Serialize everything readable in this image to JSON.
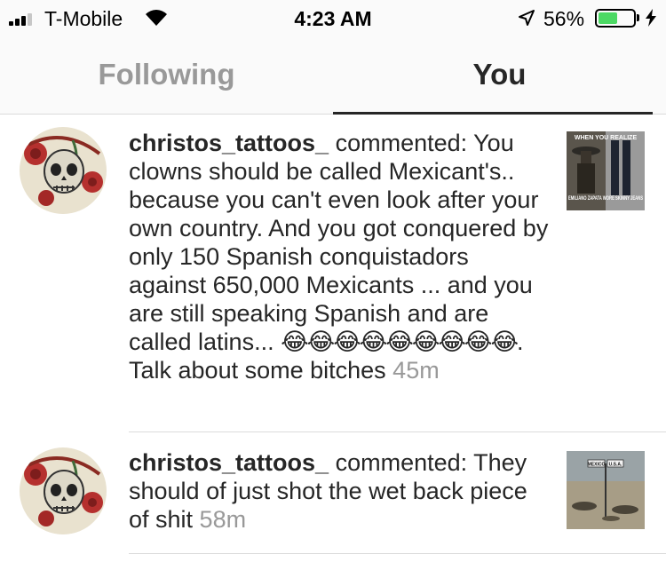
{
  "status_bar": {
    "carrier": "T-Mobile",
    "time": "4:23 AM",
    "battery_percent_text": "56%",
    "battery_level": 0.56,
    "icons": [
      "signal-icon",
      "wifi-icon",
      "location-arrow-icon",
      "battery-icon",
      "charging-bolt-icon"
    ]
  },
  "tabs": [
    {
      "label": "Following",
      "active": false
    },
    {
      "label": "You",
      "active": true
    }
  ],
  "activity": [
    {
      "username": "christos_tattoos_",
      "action": " commented: ",
      "text_before_emoji": "You clowns should be called Mexicant's.. because you can't even look after your own country. And you got conquered by only 150 Spanish conquistadors against 650,000 Mexicants ... and you are still speaking Spanish and are called latins... ",
      "emoji": "😂😂😂😂😂😂😂😂😂",
      "text_after_emoji": ". Talk about some bitches ",
      "time": "45m",
      "thumbnail": {
        "top_text": "WHEN YOU REALIZE",
        "bottom_text": "EMILIANO ZAPATA WORE SKINNY JEANS"
      }
    },
    {
      "username": "christos_tattoos_",
      "action": " commented: ",
      "text_before_emoji": "They should of just shot the wet back piece of shit ",
      "emoji": "",
      "text_after_emoji": "",
      "time": "58m",
      "thumbnail": {
        "sign_left": "MEXICO",
        "sign_right": "U.S.A."
      }
    }
  ],
  "colors": {
    "text": "#262626",
    "muted": "#999999",
    "divider": "#dbdbdb",
    "bar_background": "#fafafa",
    "battery_green": "#4cd964"
  }
}
